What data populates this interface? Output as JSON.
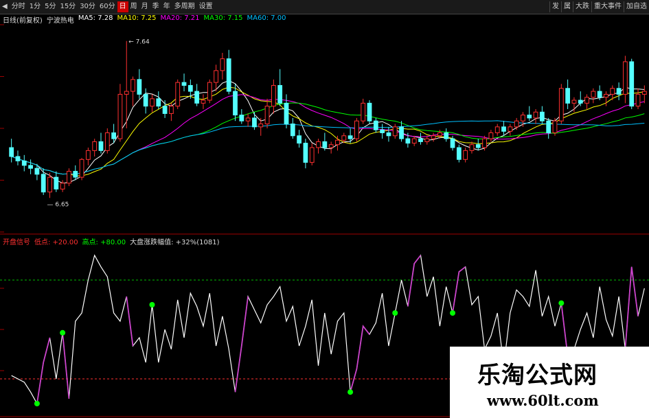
{
  "toolbar": {
    "items": [
      "◀",
      "分时",
      "1分",
      "5分",
      "15分",
      "30分",
      "60分",
      "日",
      "周",
      "月",
      "季",
      "年",
      "多周期",
      "设置"
    ],
    "active_index": 7,
    "right_items": [
      "发",
      "属",
      "大跌",
      "重大事件",
      "加自选"
    ]
  },
  "ma_legend": [
    {
      "label": "日线(前复权)",
      "color": "#dddddd"
    },
    {
      "label": "宁波热电",
      "color": "#dddddd"
    },
    {
      "label": "MA5: 7.28",
      "color": "#ffffff"
    },
    {
      "label": "MA10: 7.25",
      "color": "#ffff00"
    },
    {
      "label": "MA20: 7.21",
      "color": "#ff00ff"
    },
    {
      "label": "MA30: 7.15",
      "color": "#00ff00"
    },
    {
      "label": "MA60: 7.00",
      "color": "#00c0ff"
    }
  ],
  "indicator_legend": [
    {
      "label": "开盘信号",
      "color": "#ff3030"
    },
    {
      "label": "低点: +20.00",
      "color": "#ff3030"
    },
    {
      "label": "高点: +80.00",
      "color": "#00ff00"
    },
    {
      "label": "大盘涨跌幅值: +32%(1081)",
      "color": "#dddddd"
    }
  ],
  "colors": {
    "up": "#ff3030",
    "down": "#54ffff",
    "osc_main": "#ffffff",
    "osc_rise": "#cc44cc",
    "level_high": "#00c000",
    "level_low": "#ff3030",
    "signal": "#00ff00"
  },
  "chart_data": {
    "type": "candlestick",
    "price_range": [
      6.35,
      7.75
    ],
    "high_label": "7.64",
    "low_label": "6.65",
    "candles": [
      [
        6.92,
        6.98,
        6.82,
        6.86
      ],
      [
        6.86,
        6.9,
        6.8,
        6.83
      ],
      [
        6.83,
        6.87,
        6.76,
        6.8
      ],
      [
        6.8,
        6.84,
        6.74,
        6.78
      ],
      [
        6.78,
        6.81,
        6.7,
        6.74
      ],
      [
        6.74,
        6.78,
        6.6,
        6.62
      ],
      [
        6.62,
        6.75,
        6.58,
        6.72
      ],
      [
        6.72,
        6.76,
        6.62,
        6.64
      ],
      [
        6.64,
        6.7,
        6.62,
        6.68
      ],
      [
        6.68,
        6.78,
        6.66,
        6.76
      ],
      [
        6.76,
        6.8,
        6.7,
        6.72
      ],
      [
        6.72,
        6.85,
        6.7,
        6.84
      ],
      [
        6.84,
        6.92,
        6.8,
        6.9
      ],
      [
        6.9,
        6.98,
        6.86,
        6.96
      ],
      [
        6.96,
        7.02,
        6.88,
        6.9
      ],
      [
        6.9,
        7.05,
        6.88,
        7.02
      ],
      [
        7.02,
        7.08,
        6.95,
        6.98
      ],
      [
        6.98,
        7.35,
        6.96,
        7.28
      ],
      [
        7.28,
        7.64,
        7.05,
        7.3
      ],
      [
        7.3,
        7.4,
        7.2,
        7.38
      ],
      [
        7.38,
        7.45,
        7.25,
        7.28
      ],
      [
        7.28,
        7.32,
        7.15,
        7.2
      ],
      [
        7.2,
        7.28,
        7.16,
        7.25
      ],
      [
        7.25,
        7.3,
        7.18,
        7.2
      ],
      [
        7.2,
        7.24,
        7.12,
        7.15
      ],
      [
        7.15,
        7.22,
        7.1,
        7.2
      ],
      [
        7.2,
        7.38,
        7.18,
        7.36
      ],
      [
        7.36,
        7.42,
        7.3,
        7.34
      ],
      [
        7.34,
        7.38,
        7.25,
        7.3
      ],
      [
        7.3,
        7.35,
        7.2,
        7.22
      ],
      [
        7.22,
        7.28,
        7.18,
        7.24
      ],
      [
        7.24,
        7.38,
        7.22,
        7.36
      ],
      [
        7.36,
        7.48,
        7.3,
        7.44
      ],
      [
        7.44,
        7.56,
        7.38,
        7.52
      ],
      [
        7.52,
        7.58,
        7.28,
        7.3
      ],
      [
        7.3,
        7.35,
        7.1,
        7.14
      ],
      [
        7.14,
        7.18,
        7.08,
        7.1
      ],
      [
        7.1,
        7.15,
        7.06,
        7.12
      ],
      [
        7.12,
        7.16,
        7.04,
        7.06
      ],
      [
        7.06,
        7.12,
        7.0,
        7.08
      ],
      [
        7.08,
        7.25,
        7.05,
        7.2
      ],
      [
        7.2,
        7.38,
        7.15,
        7.34
      ],
      [
        7.34,
        7.45,
        7.2,
        7.22
      ],
      [
        7.22,
        7.28,
        7.05,
        7.08
      ],
      [
        7.08,
        7.12,
        6.98,
        7.0
      ],
      [
        7.0,
        7.04,
        6.92,
        6.95
      ],
      [
        6.95,
        6.98,
        6.78,
        6.82
      ],
      [
        6.82,
        6.95,
        6.8,
        6.92
      ],
      [
        6.92,
        6.98,
        6.88,
        6.96
      ],
      [
        6.96,
        7.02,
        6.9,
        6.92
      ],
      [
        6.92,
        6.96,
        6.88,
        6.94
      ],
      [
        6.94,
        7.0,
        6.9,
        6.97
      ],
      [
        6.97,
        7.02,
        6.95,
        7.0
      ],
      [
        7.0,
        7.05,
        6.95,
        6.98
      ],
      [
        6.98,
        7.12,
        6.96,
        7.1
      ],
      [
        7.1,
        7.25,
        7.08,
        7.22
      ],
      [
        7.22,
        7.24,
        7.08,
        7.1
      ],
      [
        7.1,
        7.12,
        7.02,
        7.04
      ],
      [
        7.04,
        7.08,
        6.98,
        7.02
      ],
      [
        7.02,
        7.06,
        6.96,
        7.0
      ],
      [
        7.0,
        7.08,
        6.98,
        7.06
      ],
      [
        7.06,
        7.1,
        6.96,
        6.98
      ],
      [
        6.98,
        7.02,
        6.92,
        6.95
      ],
      [
        6.95,
        7.0,
        6.93,
        6.98
      ],
      [
        6.98,
        7.02,
        6.94,
        6.96
      ],
      [
        6.96,
        7.0,
        6.94,
        6.98
      ],
      [
        6.98,
        7.02,
        6.96,
        7.0
      ],
      [
        7.0,
        7.04,
        6.98,
        7.02
      ],
      [
        7.02,
        7.05,
        6.96,
        6.98
      ],
      [
        6.98,
        7.0,
        6.9,
        6.92
      ],
      [
        6.92,
        6.94,
        6.82,
        6.84
      ],
      [
        6.84,
        6.92,
        6.82,
        6.9
      ],
      [
        6.9,
        6.96,
        6.88,
        6.94
      ],
      [
        6.94,
        6.98,
        6.9,
        6.92
      ],
      [
        6.92,
        7.0,
        6.9,
        6.98
      ],
      [
        6.98,
        7.04,
        6.96,
        7.02
      ],
      [
        7.02,
        7.08,
        7.0,
        7.06
      ],
      [
        7.06,
        7.1,
        7.0,
        7.03
      ],
      [
        7.03,
        7.08,
        7.0,
        7.06
      ],
      [
        7.06,
        7.12,
        7.04,
        7.1
      ],
      [
        7.1,
        7.16,
        7.06,
        7.14
      ],
      [
        7.14,
        7.2,
        7.1,
        7.12
      ],
      [
        7.12,
        7.18,
        7.08,
        7.16
      ],
      [
        7.16,
        7.2,
        7.08,
        7.1
      ],
      [
        7.1,
        7.12,
        6.98,
        7.02
      ],
      [
        7.02,
        7.12,
        7.0,
        7.1
      ],
      [
        7.1,
        7.35,
        7.08,
        7.32
      ],
      [
        7.32,
        7.38,
        7.18,
        7.22
      ],
      [
        7.22,
        7.26,
        7.16,
        7.24
      ],
      [
        7.24,
        7.3,
        7.2,
        7.22
      ],
      [
        7.22,
        7.28,
        7.18,
        7.26
      ],
      [
        7.26,
        7.32,
        7.22,
        7.3
      ],
      [
        7.3,
        7.34,
        7.24,
        7.26
      ],
      [
        7.26,
        7.3,
        7.2,
        7.28
      ],
      [
        7.28,
        7.34,
        7.24,
        7.32
      ],
      [
        7.32,
        7.36,
        7.24,
        7.28
      ],
      [
        7.28,
        7.54,
        7.22,
        7.5
      ],
      [
        7.5,
        7.52,
        7.18,
        7.2
      ],
      [
        7.2,
        7.32,
        7.18,
        7.28
      ],
      [
        7.28,
        7.34,
        7.22,
        7.3
      ]
    ],
    "indicator": {
      "range": [
        0,
        100
      ],
      "levels": {
        "high": 80,
        "low": 20
      },
      "values": [
        22,
        20,
        18,
        12,
        5,
        30,
        45,
        20,
        48,
        8,
        55,
        60,
        80,
        95,
        88,
        82,
        60,
        55,
        70,
        40,
        45,
        30,
        65,
        30,
        50,
        38,
        68,
        45,
        72,
        64,
        52,
        72,
        40,
        58,
        38,
        12,
        40,
        70,
        62,
        54,
        65,
        70,
        76,
        55,
        64,
        40,
        52,
        68,
        28,
        60,
        35,
        55,
        60,
        12,
        26,
        52,
        47,
        54,
        72,
        40,
        60,
        80,
        64,
        90,
        95,
        70,
        82,
        52,
        76,
        60,
        85,
        88,
        65,
        70,
        38,
        46,
        60,
        28,
        60,
        74,
        70,
        64,
        86,
        58,
        70,
        52,
        66,
        34,
        38,
        50,
        60,
        45,
        76,
        56,
        46,
        70,
        38,
        88,
        58,
        75
      ],
      "rise_segments": [
        [
          4,
          6
        ],
        [
          8,
          9
        ],
        [
          18,
          19
        ],
        [
          35,
          37
        ],
        [
          53,
          56
        ],
        [
          62,
          64
        ],
        [
          69,
          71
        ],
        [
          86,
          88
        ],
        [
          96,
          98
        ]
      ],
      "signals": [
        4,
        8,
        22,
        53,
        60,
        69,
        86,
        96
      ]
    }
  },
  "watermark": {
    "title": "乐淘公式网",
    "url": "www.60lt.com"
  }
}
